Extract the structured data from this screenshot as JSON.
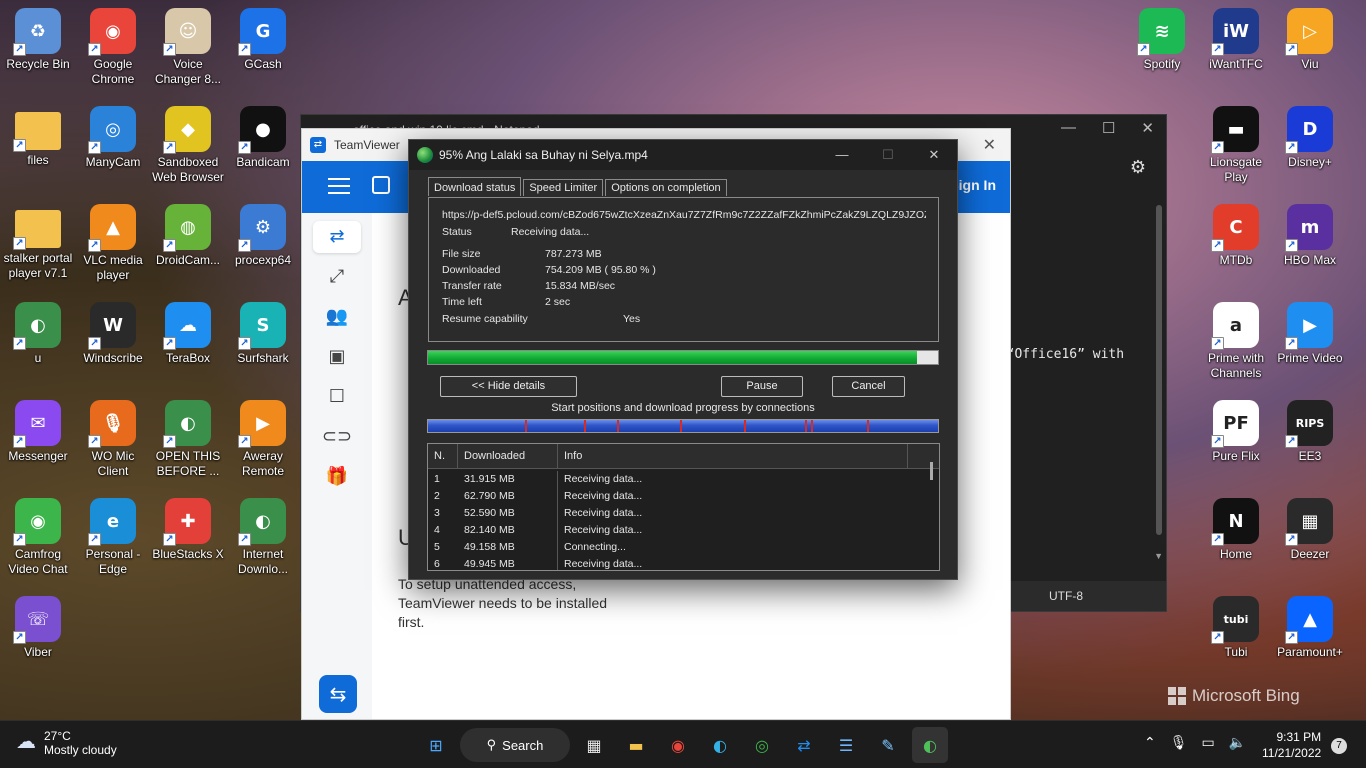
{
  "desktop": {
    "icons_left": [
      {
        "label": "Recycle Bin",
        "icon": "recycle-bin-icon",
        "color": "#5b8fd6",
        "glyph": "♻"
      },
      {
        "label": "Google Chrome",
        "icon": "chrome-icon",
        "color": "#e9453a",
        "glyph": "◉"
      },
      {
        "label": "Voice Changer 8...",
        "icon": "voice-changer-icon",
        "color": "#d8c7a8",
        "glyph": "☺"
      },
      {
        "label": "GCash",
        "icon": "gcash-icon",
        "color": "#1d72e8",
        "glyph": "G"
      },
      {
        "label": "files",
        "icon": "folder-icon",
        "color": "#f2c14e",
        "glyph": ""
      },
      {
        "label": "ManyCam",
        "icon": "manycam-icon",
        "color": "#2b82d9",
        "glyph": "◎"
      },
      {
        "label": "Sandboxed Web Browser",
        "icon": "sandboxie-icon",
        "color": "#e2c420",
        "glyph": "◆"
      },
      {
        "label": "Bandicam",
        "icon": "bandicam-icon",
        "color": "#111111",
        "glyph": "●"
      },
      {
        "label": "stalker portal player v7.1",
        "icon": "folder-icon",
        "color": "#f2c14e",
        "glyph": ""
      },
      {
        "label": "VLC media player",
        "icon": "vlc-icon",
        "color": "#f08a1c",
        "glyph": "▲"
      },
      {
        "label": "DroidCam...",
        "icon": "droidcam-icon",
        "color": "#67b33a",
        "glyph": "◍"
      },
      {
        "label": "procexp64",
        "icon": "procexp-icon",
        "color": "#3b7bd4",
        "glyph": "⚙"
      },
      {
        "label": "u",
        "icon": "idm-icon",
        "color": "#3a8f4a",
        "glyph": "◐"
      },
      {
        "label": "Windscribe",
        "icon": "windscribe-icon",
        "color": "#2a2a2a",
        "glyph": "W"
      },
      {
        "label": "TeraBox",
        "icon": "terabox-icon",
        "color": "#1e8ef0",
        "glyph": "☁"
      },
      {
        "label": "Surfshark",
        "icon": "surfshark-icon",
        "color": "#1ab3b5",
        "glyph": "S"
      },
      {
        "label": "Messenger",
        "icon": "messenger-icon",
        "color": "#8a4af0",
        "glyph": "✉"
      },
      {
        "label": "WO Mic Client",
        "icon": "wo-mic-icon",
        "color": "#e86a1c",
        "glyph": "🎙"
      },
      {
        "label": "OPEN THIS BEFORE ...",
        "icon": "idm-icon",
        "color": "#3a8f4a",
        "glyph": "◐"
      },
      {
        "label": "Aweray Remote",
        "icon": "aweray-icon",
        "color": "#f08a1c",
        "glyph": "▶"
      },
      {
        "label": "Camfrog Video Chat",
        "icon": "camfrog-icon",
        "color": "#3cb54a",
        "glyph": "◉"
      },
      {
        "label": "Personal - Edge",
        "icon": "edge-icon",
        "color": "#1a8fd8",
        "glyph": "e"
      },
      {
        "label": "BlueStacks X",
        "icon": "bluestacks-icon",
        "color": "#e4403a",
        "glyph": "✚"
      },
      {
        "label": "Internet Downlo...",
        "icon": "idm-icon",
        "color": "#3a8f4a",
        "glyph": "◐"
      },
      {
        "label": "Viber",
        "icon": "viber-icon",
        "color": "#7a4fd0",
        "glyph": "☏"
      }
    ],
    "icons_right": [
      {
        "label": "Spotify",
        "icon": "spotify-icon",
        "color": "#1db954",
        "glyph": "≋"
      },
      {
        "label": "iWantTFC",
        "icon": "iwanttfc-icon",
        "color": "#203a8c",
        "glyph": "iW"
      },
      {
        "label": "Viu",
        "icon": "viu-icon",
        "color": "#f6a623",
        "glyph": "▷"
      },
      {
        "label": "Lionsgate Play",
        "icon": "lionsgate-icon",
        "color": "#111111",
        "glyph": "▬"
      },
      {
        "label": "Disney+",
        "icon": "disney-plus-icon",
        "color": "#1a3bd6",
        "glyph": "D"
      },
      {
        "label": "MTDb",
        "icon": "mtdb-icon",
        "color": "#e23c2a",
        "glyph": "C"
      },
      {
        "label": "HBO Max",
        "icon": "hbo-max-icon",
        "color": "#5a2fa0",
        "glyph": "m"
      },
      {
        "label": "Prime with Channels",
        "icon": "amazon-icon",
        "color": "#ffffff",
        "glyph": "a"
      },
      {
        "label": "Prime Video",
        "icon": "prime-video-icon",
        "color": "#1e8ef0",
        "glyph": "▶"
      },
      {
        "label": "Pure Flix",
        "icon": "pure-flix-icon",
        "color": "#ffffff",
        "glyph": "PF"
      },
      {
        "label": "EE3",
        "icon": "rips-icon",
        "color": "#222222",
        "glyph": "RIPS"
      },
      {
        "label": "Home",
        "icon": "netflix-icon",
        "color": "#111111",
        "glyph": "N"
      },
      {
        "label": "Deezer",
        "icon": "deezer-icon",
        "color": "#2a2a2a",
        "glyph": "▦"
      },
      {
        "label": "Tubi",
        "icon": "tubi-icon",
        "color": "#2a2a2a",
        "glyph": "tubi"
      },
      {
        "label": "Paramount+",
        "icon": "paramount-icon",
        "color": "#0a64ff",
        "glyph": "▲"
      }
    ]
  },
  "notepad": {
    "title": "office and win 10 lic.cmd - Notepad",
    "visible_text": "e “Office16” with",
    "encoding": "UTF-8"
  },
  "teamviewer": {
    "title": "TeamViewer",
    "sign_in": "Sign In",
    "heading_a": "A",
    "heading_u": "U",
    "setup_text": "To setup unattended access, TeamViewer needs to be installed first."
  },
  "idm": {
    "title": "95% Ang Lalaki sa Buhay ni Selya.mp4",
    "tabs": [
      "Download status",
      "Speed Limiter",
      "Options on completion"
    ],
    "url": "https://p-def5.pcloud.com/cBZod675wZtcXzeaZnXau7Z7ZfRm9c7Z2ZZafFZkZhmiPcZakZ9LZQLZ9JZOZ",
    "status_label": "Status",
    "status_value": "Receiving data...",
    "file_size_label": "File size",
    "file_size_value": "787.273  MB",
    "downloaded_label": "Downloaded",
    "downloaded_value": "754.209  MB  ( 95.80 % )",
    "transfer_rate_label": "Transfer rate",
    "transfer_rate_value": "15.834  MB/sec",
    "time_left_label": "Time left",
    "time_left_value": "2 sec",
    "resume_label": "Resume capability",
    "resume_value": "Yes",
    "progress_fraction": 0.958,
    "hide_details": "<< Hide details",
    "pause": "Pause",
    "cancel": "Cancel",
    "connections_label": "Start positions and download progress by connections",
    "connection_marks": [
      0.19,
      0.305,
      0.37,
      0.495,
      0.62,
      0.74,
      0.75,
      0.86
    ],
    "grid_headers": [
      "N.",
      "Downloaded",
      "Info"
    ],
    "connections": [
      {
        "n": "1",
        "downloaded": "31.915  MB",
        "info": "Receiving data..."
      },
      {
        "n": "2",
        "downloaded": "62.790  MB",
        "info": "Receiving data..."
      },
      {
        "n": "3",
        "downloaded": "52.590  MB",
        "info": "Receiving data..."
      },
      {
        "n": "4",
        "downloaded": "82.140  MB",
        "info": "Receiving data..."
      },
      {
        "n": "5",
        "downloaded": "49.158  MB",
        "info": "Connecting..."
      },
      {
        "n": "6",
        "downloaded": "49.945  MB",
        "info": "Receiving data..."
      }
    ]
  },
  "taskbar": {
    "temperature": "27°C",
    "weather": "Mostly cloudy",
    "search": "Search",
    "time": "9:31 PM",
    "date": "11/21/2022",
    "notifications": "7",
    "apps": [
      "windows-start-icon",
      "search",
      "store-icon",
      "file-explorer-icon",
      "chrome-icon",
      "edge-icon",
      "camfrog-icon",
      "teamviewer-icon",
      "notepad-icon",
      "paint-icon",
      "idm-icon"
    ]
  },
  "watermark": "Microsoft Bing"
}
